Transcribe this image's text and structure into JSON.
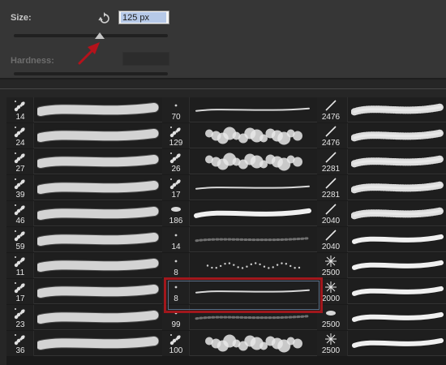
{
  "size": {
    "label": "Size:",
    "value": "125 px",
    "slider_fraction": 0.56
  },
  "hardness": {
    "label": "Hardness:",
    "value": ""
  },
  "brushes": {
    "column1": [
      "14",
      "24",
      "27",
      "39",
      "46",
      "59",
      "11",
      "17",
      "23",
      "36"
    ],
    "column2": [
      "70",
      "129",
      "26",
      "17",
      "186",
      "14",
      "8",
      "8",
      "99",
      "100"
    ],
    "column3": [
      "2476",
      "2476",
      "2281",
      "2281",
      "2040",
      "2040",
      "2500",
      "2000",
      "2500",
      "2500"
    ],
    "selected": {
      "column": 2,
      "index": 7
    }
  },
  "colors": {
    "panel": "#363636",
    "grid": "#1a1a1a",
    "selection": "#a1171c",
    "field_highlight": "#b6c9e8",
    "annotation_arrow": "#b5121b"
  },
  "icons": {
    "reset": "reset-arrow-icon",
    "annotation": "red-pointer-arrow"
  }
}
